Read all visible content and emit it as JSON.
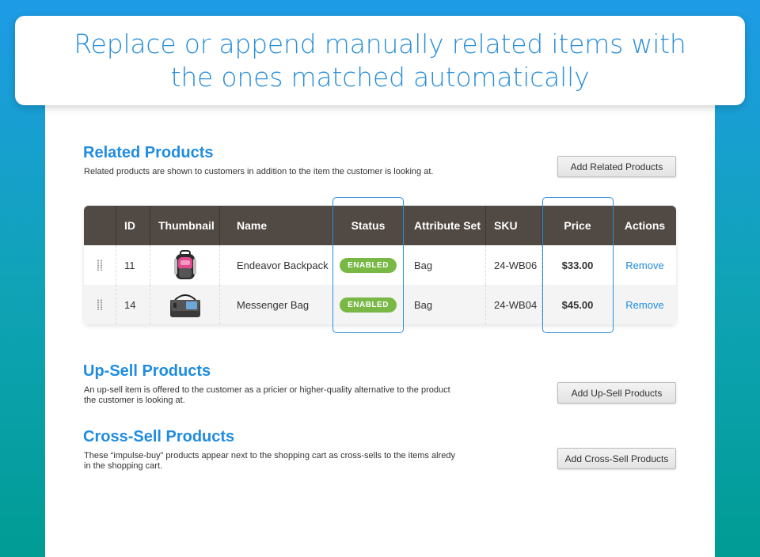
{
  "banner": {
    "line1": "Replace or append manually related items with",
    "line2": "the ones matched automatically"
  },
  "related": {
    "title": "Related Products",
    "description": "Related products are shown to customers in addition to the item the customer is looking at.",
    "button": "Add Related Products"
  },
  "grid": {
    "headers": {
      "id": "ID",
      "thumbnail": "Thumbnail",
      "name": "Name",
      "status": "Status",
      "attribute_set": "Attribute Set",
      "sku": "SKU",
      "price": "Price",
      "actions": "Actions"
    },
    "rows": [
      {
        "id": "11",
        "name": "Endeavor Backpack",
        "status": "ENABLED",
        "attribute_set": "Bag",
        "sku": "24-WB06",
        "price": "$33.00",
        "action": "Remove",
        "thumb_icon": "backpack-icon"
      },
      {
        "id": "14",
        "name": "Messenger Bag",
        "status": "ENABLED",
        "attribute_set": "Bag",
        "sku": "24-WB04",
        "price": "$45.00",
        "action": "Remove",
        "thumb_icon": "messenger-bag-icon"
      }
    ]
  },
  "upsell": {
    "title": "Up-Sell Products",
    "description": "An up-sell item is offered to the customer as a pricier or higher-quality alternative to the product the customer is looking at.",
    "button": "Add Up-Sell Products"
  },
  "crosssell": {
    "title": "Cross-Sell Products",
    "description": "These “impulse-buy” products appear next to the shopping cart as cross-sells to the items alredy in the shopping cart.",
    "button": "Add Cross-Sell Products"
  },
  "colors": {
    "accent": "#1f8ce0",
    "header_bg": "#514943",
    "badge_green": "#79b845"
  }
}
